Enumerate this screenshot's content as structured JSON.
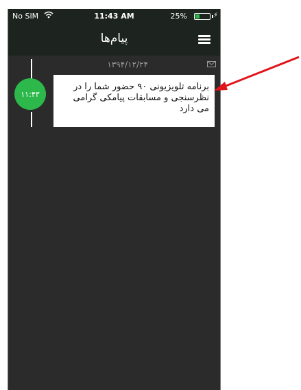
{
  "status_bar": {
    "carrier": "No SIM",
    "time": "11:43 AM",
    "battery": "25%"
  },
  "header": {
    "title": "پیام‌ها"
  },
  "messages": [
    {
      "date": "۱۳۹۴/۱۲/۲۴",
      "time": "۱۱:۴۳",
      "text": "برنامه تلویزیونی ۹۰ حضور شما را در نظرسنجی و مسابقات پیامکی گرامی می دارد"
    }
  ],
  "colors": {
    "background": "#2b2b2b",
    "bar": "#1d241f",
    "accent": "#2db84b",
    "annotation_arrow": "#e0151b"
  },
  "icons": {
    "menu": "hamburger-menu-icon",
    "message": "envelope-icon",
    "wifi": "wifi-icon",
    "battery": "battery-icon"
  }
}
